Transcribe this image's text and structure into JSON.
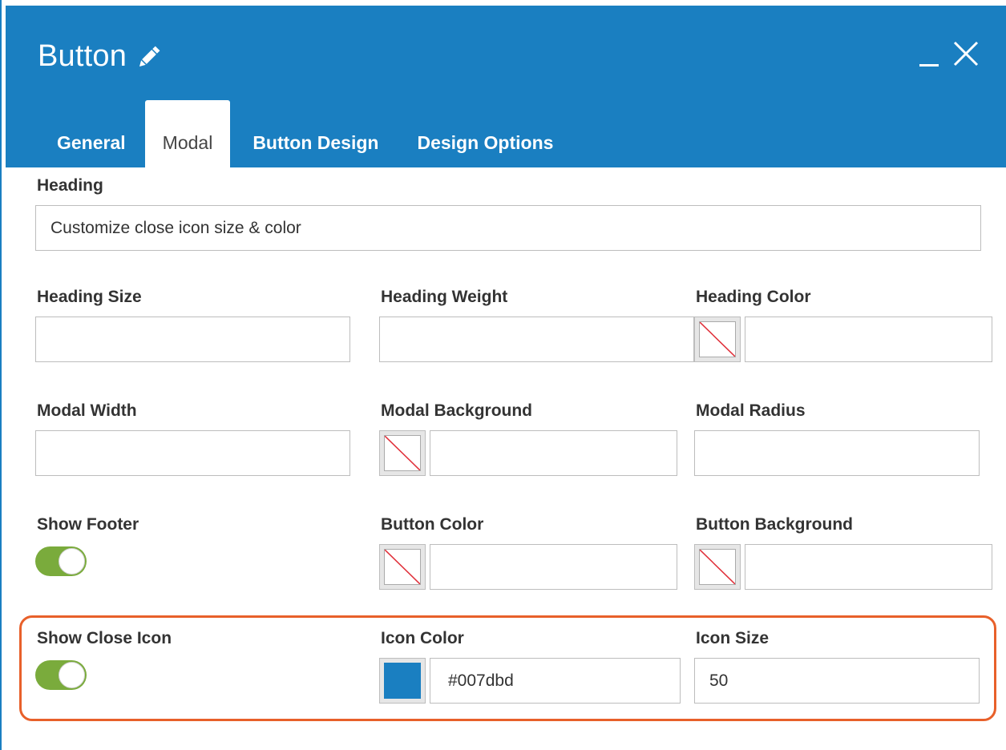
{
  "window": {
    "title": "Button",
    "tabs": [
      {
        "label": "General",
        "active": false
      },
      {
        "label": "Modal",
        "active": true
      },
      {
        "label": "Button Design",
        "active": false
      },
      {
        "label": "Design Options",
        "active": false
      }
    ]
  },
  "colors": {
    "header": "#1a7fc1",
    "toggle_on": "#7aab3c",
    "highlight_border": "#e8602a"
  },
  "form": {
    "heading": {
      "label": "Heading",
      "value": "Customize close icon size & color"
    },
    "heading_size": {
      "label": "Heading Size",
      "value": ""
    },
    "heading_weight": {
      "label": "Heading Weight",
      "value": ""
    },
    "heading_color": {
      "label": "Heading Color",
      "value": ""
    },
    "modal_width": {
      "label": "Modal Width",
      "value": ""
    },
    "modal_background": {
      "label": "Modal Background",
      "value": ""
    },
    "modal_radius": {
      "label": "Modal Radius",
      "value": ""
    },
    "show_footer": {
      "label": "Show Footer",
      "on": true
    },
    "button_color": {
      "label": "Button Color",
      "value": ""
    },
    "button_background": {
      "label": "Button Background",
      "value": ""
    },
    "show_close_icon": {
      "label": "Show Close Icon",
      "on": true
    },
    "icon_color": {
      "label": "Icon Color",
      "value": "#007dbd"
    },
    "icon_size": {
      "label": "Icon Size",
      "value": "50"
    }
  },
  "icons": {
    "edit": "pencil-icon",
    "minimize": "minimize-icon",
    "close": "close-icon",
    "empty_swatch": "no-color-swatch"
  }
}
